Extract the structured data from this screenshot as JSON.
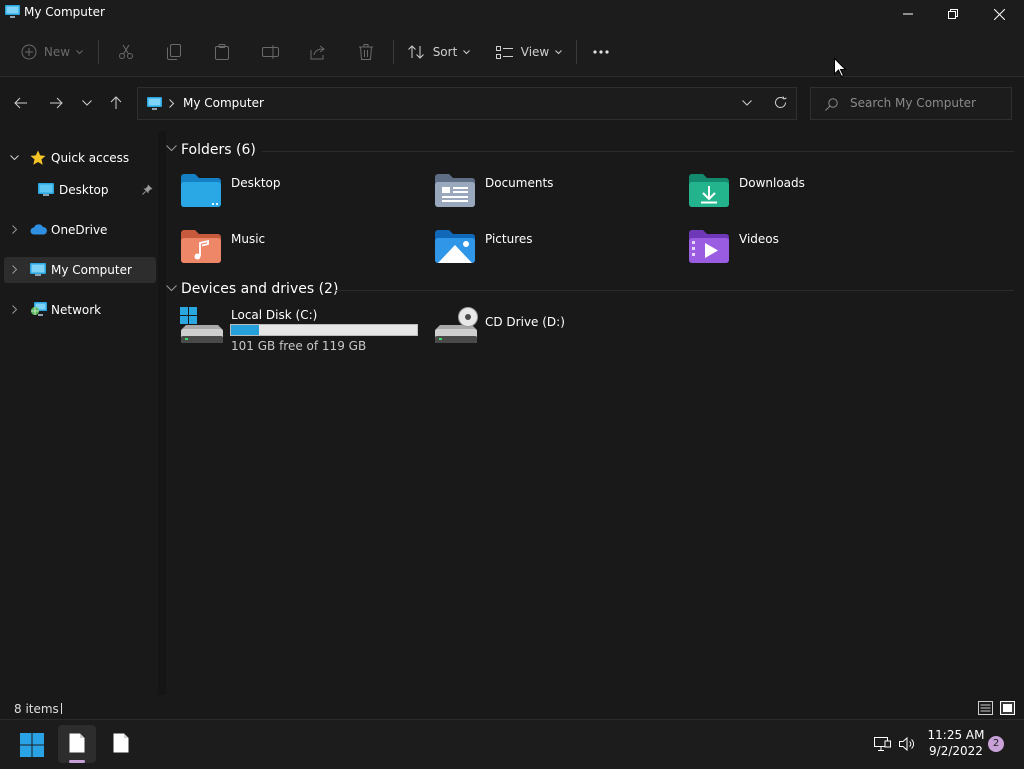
{
  "window": {
    "title": "My Computer"
  },
  "toolbar": {
    "new_label": "New",
    "sort_label": "Sort",
    "view_label": "View"
  },
  "address": {
    "path": "My Computer"
  },
  "search": {
    "placeholder": "Search My Computer"
  },
  "sidebar": {
    "items": [
      {
        "label": "Quick access",
        "icon": "star-icon"
      },
      {
        "label": "Desktop",
        "icon": "desktop-icon"
      },
      {
        "label": "OneDrive",
        "icon": "cloud-icon"
      },
      {
        "label": "My Computer",
        "icon": "computer-icon"
      },
      {
        "label": "Network",
        "icon": "network-icon"
      }
    ]
  },
  "folders": {
    "heading": "Folders (6)",
    "items": [
      {
        "label": "Desktop",
        "icon": "desktop-folder-icon"
      },
      {
        "label": "Documents",
        "icon": "documents-folder-icon"
      },
      {
        "label": "Downloads",
        "icon": "downloads-folder-icon"
      },
      {
        "label": "Music",
        "icon": "music-folder-icon"
      },
      {
        "label": "Pictures",
        "icon": "pictures-folder-icon"
      },
      {
        "label": "Videos",
        "icon": "videos-folder-icon"
      }
    ]
  },
  "drives": {
    "heading": "Devices and drives (2)",
    "items": [
      {
        "label": "Local Disk (C:)",
        "free_text": "101 GB free of 119 GB",
        "used_fraction": 0.151,
        "icon": "hard-drive-icon"
      },
      {
        "label": "CD Drive (D:)",
        "icon": "cd-drive-icon"
      }
    ]
  },
  "status": {
    "items_count": "8 items"
  },
  "taskbar": {
    "time": "11:25 AM",
    "date": "9/2/2022",
    "notification_count": "2"
  },
  "colors": {
    "accent": "#26a0da",
    "background": "#191919",
    "notification_badge": "#c7a1d8"
  }
}
